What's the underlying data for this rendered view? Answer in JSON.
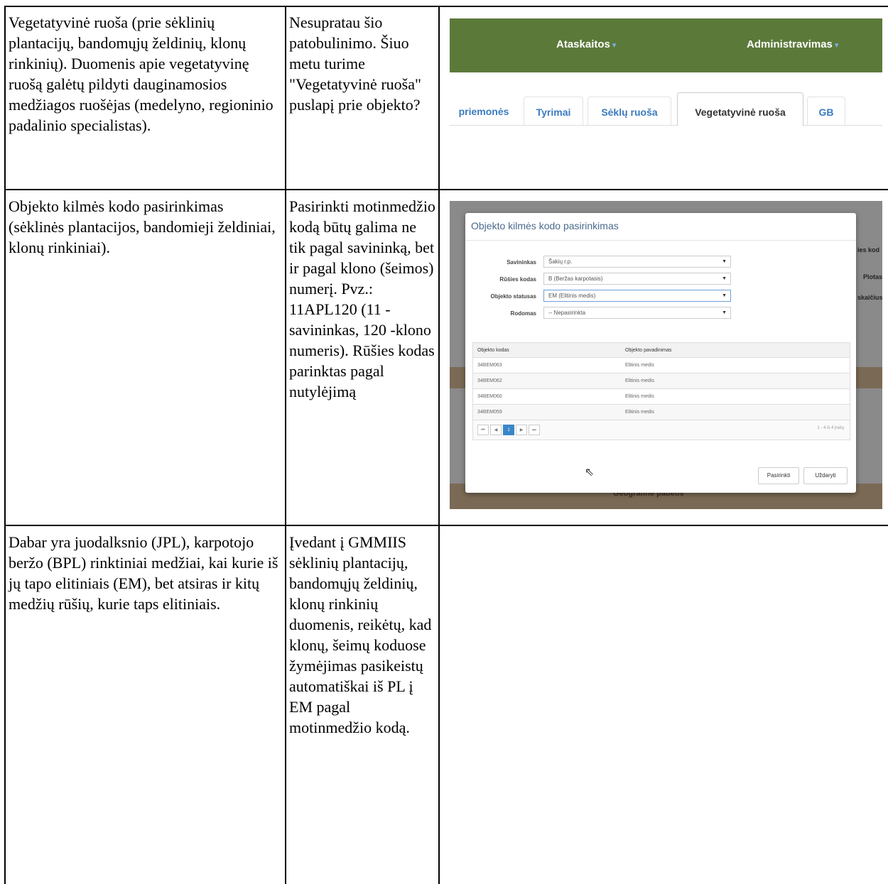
{
  "rows": [
    {
      "desc": "Vegetatyvinė ruoša (prie sėklinių plantacijų, bandomųjų želdinių, klonų rinkinių). Duomenis apie vegetatyvinę ruošą galėtų pildyti dauginamosios medžiagos ruošėjas (medelyno, regioninio padalinio specialistas).",
      "comment": "Nesupratau šio patobulinimo. Šiuo metu turime \"Vegetatyvinė ruoša\" puslapį prie objekto?"
    },
    {
      "desc": "Objekto kilmės kodo pasirinkimas (sėklinės plantacijos, bandomieji želdiniai, klonų rinkiniai).",
      "comment": "Pasirinkti motinmedžio kodą būtų galima ne tik pagal savininką, bet ir pagal klono (šeimos) numerį. Pvz.: 11APL120 (11 -savininkas, 120 -klono numeris). Rūšies kodas parinktas pagal nutylėjimą"
    },
    {
      "desc": "Dabar yra juodalksnio (JPL), karpotojo beržo (BPL) rinktiniai medžiai, kai kurie iš jų tapo elitiniais (EM), bet atsiras ir kitų medžių rūšių, kurie taps elitiniais.",
      "comment": "Įvedant į GMMIIS sėklinių plantacijų, bandomųjų želdinių, klonų rinkinių duomenis, reikėtų, kad klonų, šeimų koduose žymėjimas pasikeistų automatiškai iš PL į EM pagal motinmedžio kodą."
    }
  ],
  "screenshot1": {
    "nav": [
      "Ataskaitos",
      "Administravimas"
    ],
    "tabs": [
      "priemonės",
      "Tyrimai",
      "Sėklų ruoša",
      "Vegetatyvinė ruoša",
      "GB"
    ],
    "active_tab": "Vegetatyvinė ruoša",
    "colors": {
      "navbar": "#5b7a3a",
      "tab_link": "#3a7bbf"
    }
  },
  "screenshot2": {
    "modal_title": "Objekto kilmės kodo pasirinkimas",
    "fields": [
      {
        "label": "Savininkas",
        "value": "Šakių r.p."
      },
      {
        "label": "Rūšies kodas",
        "value": "B (Beržas karpotasis)"
      },
      {
        "label": "Objekto statusas",
        "value": "EM (Elitinis medis)"
      },
      {
        "label": "Rodomas",
        "value": "-- Nepasirinkta"
      }
    ],
    "grid_headers": [
      "Objekto kodas",
      "Objekto pavadinimas"
    ],
    "grid_rows": [
      [
        "34BEM063",
        "Elitinis medis"
      ],
      [
        "34BEM062",
        "Elitinis medis"
      ],
      [
        "34BEM060",
        "Elitinis medis"
      ],
      [
        "34BEM059",
        "Elitinis medis"
      ]
    ],
    "pager_current": "1",
    "pager_info": "1 - 4 iš 4 įrašų",
    "buttons": [
      "Pasirinkti",
      "Uždaryti"
    ],
    "background_text": {
      "geo": "Geografinė padėtis",
      "plotas": "Plotas",
      "skaicius": "skaičius",
      "kod": "ies kod"
    }
  }
}
